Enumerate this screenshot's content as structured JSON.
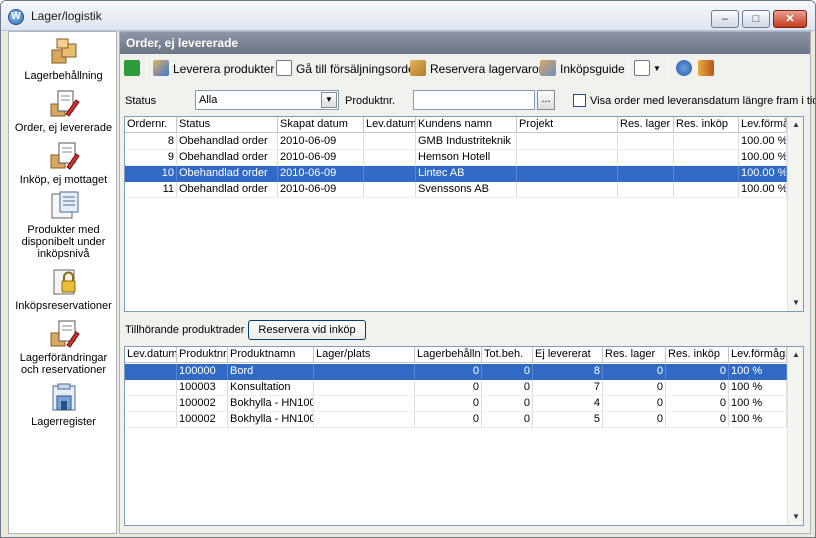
{
  "window": {
    "title": "Lager/logistik",
    "icon": "app-logo-icon",
    "controls": {
      "minimize": "–",
      "maximize": "□",
      "close": "✕"
    }
  },
  "sidebar": {
    "items": [
      {
        "label": "Lagerbehållning",
        "icon": "boxes-icon"
      },
      {
        "label": "Order, ej levererade",
        "icon": "order-pencil-icon"
      },
      {
        "label": "Inköp, ej mottaget",
        "icon": "purchase-icon"
      },
      {
        "label": "Produkter med disponibelt under inköpsnivå",
        "icon": "products-below-level-icon"
      },
      {
        "label": "Inköpsreservationer",
        "icon": "purchase-reservation-icon"
      },
      {
        "label": "Lagerförändringar och reservationer",
        "icon": "stock-changes-icon"
      },
      {
        "label": "Lagerregister",
        "icon": "warehouse-register-icon"
      }
    ]
  },
  "main": {
    "header": "Order, ej levererade",
    "toolbar": {
      "refresh_icon": "refresh-icon",
      "deliver": "Leverera produkter",
      "goto_sales": "Gå till försäljningsorder",
      "reserve": "Reservera lagervaror",
      "purchase_guide": "Inköpsguide",
      "report_icon": "report-icon",
      "dropdown_arrow": "▼",
      "help_icon": "help-icon",
      "exit_icon": "exit-icon"
    },
    "filters": {
      "status_label": "Status",
      "status_value": "Alla",
      "combo_arrow": "▼",
      "product_label": "Produktnr.",
      "product_value": "",
      "browse": "...",
      "future_label": "Visa order med leveransdatum längre fram i tid",
      "future_checked": false
    },
    "orders": {
      "columns": [
        "Ordernr.",
        "Status",
        "Skapat datum",
        "Lev.datum",
        "Kundens namn",
        "Projekt",
        "Res. lager",
        "Res. inköp",
        "Lev.förmåga"
      ],
      "rows": [
        {
          "nr": "8",
          "status": "Obehandlad order",
          "created": "2010-06-09",
          "delivery": "",
          "customer": "GMB Industriteknik",
          "project": "",
          "res_stock": "",
          "res_purchase": "",
          "capacity": "100.00 %",
          "selected": false
        },
        {
          "nr": "9",
          "status": "Obehandlad order",
          "created": "2010-06-09",
          "delivery": "",
          "customer": "Hemson Hotell",
          "project": "",
          "res_stock": "",
          "res_purchase": "",
          "capacity": "100.00 %",
          "selected": false
        },
        {
          "nr": "10",
          "status": "Obehandlad order",
          "created": "2010-06-09",
          "delivery": "",
          "customer": "Lintec AB",
          "project": "",
          "res_stock": "",
          "res_purchase": "",
          "capacity": "100.00 %",
          "selected": true
        },
        {
          "nr": "11",
          "status": "Obehandlad order",
          "created": "2010-06-09",
          "delivery": "",
          "customer": "Svenssons AB",
          "project": "",
          "res_stock": "",
          "res_purchase": "",
          "capacity": "100.00 %",
          "selected": false
        }
      ]
    },
    "products_label": "Tillhörande produktrader",
    "reserve_button": "Reservera vid inköp",
    "products": {
      "columns": [
        "Lev.datum",
        "Produktnr.",
        "Produktnamn",
        "Lager/plats",
        "Lagerbehållning",
        "Tot.beh.",
        "Ej levererat",
        "Res. lager",
        "Res. inköp",
        "Lev.förmåga"
      ],
      "rows": [
        {
          "delivery": "",
          "nr": "100000",
          "name": "Bord",
          "location": "",
          "stock": "0",
          "total": "0",
          "undelivered": "8",
          "res_stock": "0",
          "res_purchase": "0",
          "capacity": "100 %",
          "selected": true
        },
        {
          "delivery": "",
          "nr": "100003",
          "name": "Konsultation",
          "location": "",
          "stock": "0",
          "total": "0",
          "undelivered": "7",
          "res_stock": "0",
          "res_purchase": "0",
          "capacity": "100 %",
          "selected": false
        },
        {
          "delivery": "",
          "nr": "100002",
          "name": "Bokhylla - HN100",
          "location": "",
          "stock": "0",
          "total": "0",
          "undelivered": "4",
          "res_stock": "0",
          "res_purchase": "0",
          "capacity": "100 %",
          "selected": false
        },
        {
          "delivery": "",
          "nr": "100002",
          "name": "Bokhylla - HN100",
          "location": "",
          "stock": "0",
          "total": "0",
          "undelivered": "5",
          "res_stock": "0",
          "res_purchase": "0",
          "capacity": "100 %",
          "selected": false
        }
      ]
    },
    "scroll": {
      "up": "▲",
      "down": "▼"
    }
  },
  "colors": {
    "selection": "#316ac5",
    "header": "#7b8594",
    "sidebar_bg": "#ffffff"
  }
}
